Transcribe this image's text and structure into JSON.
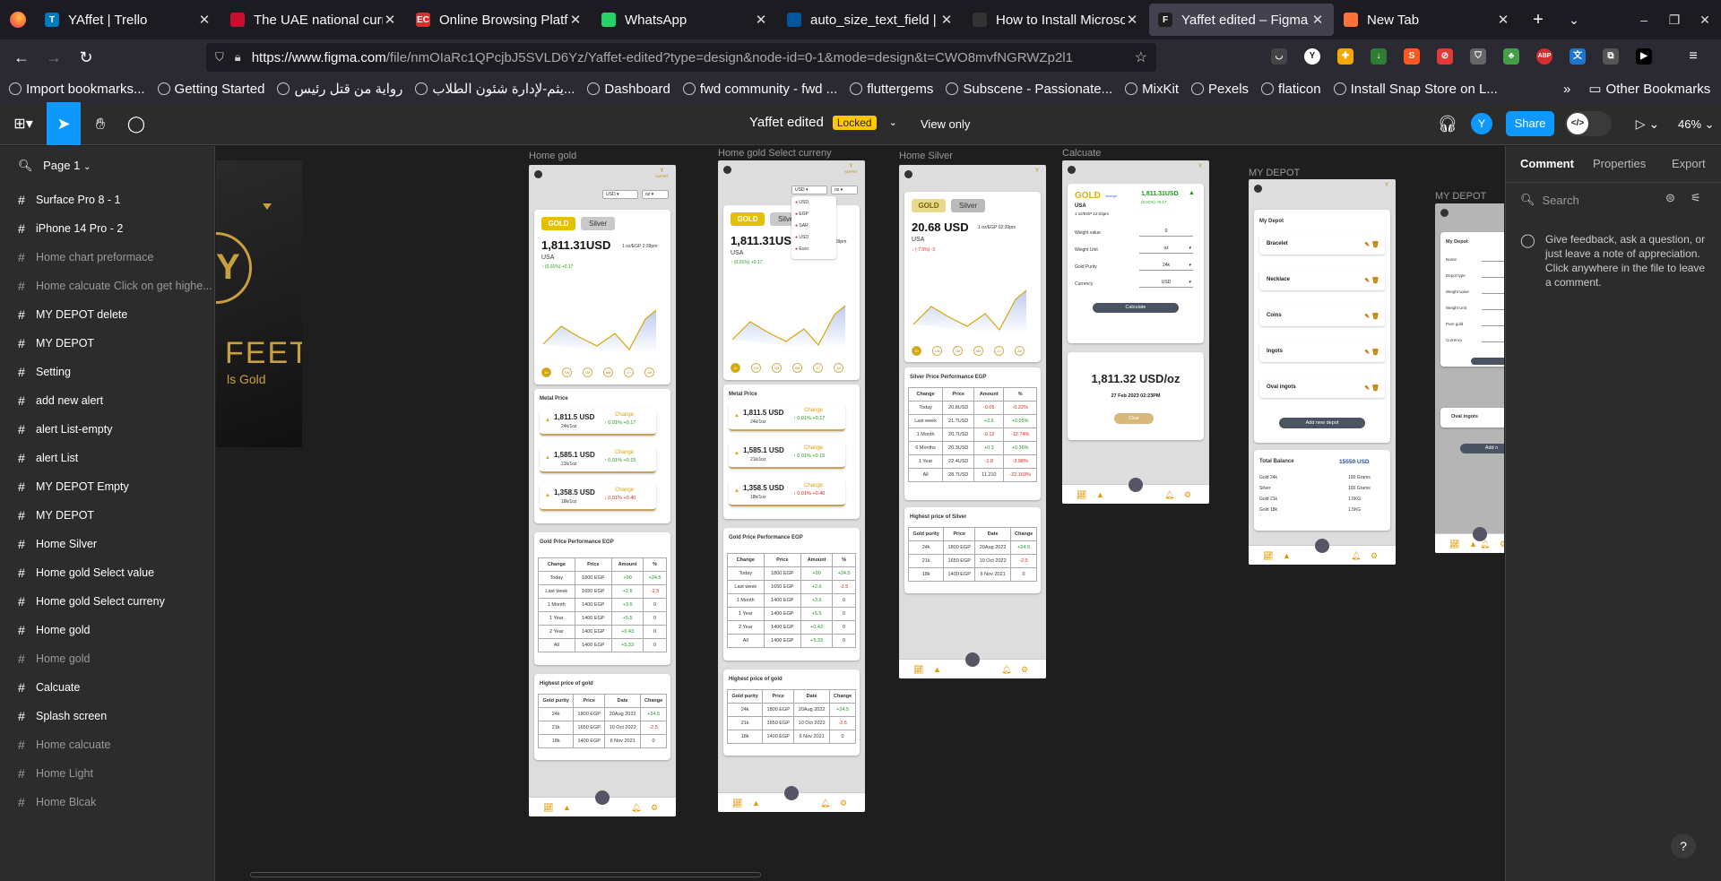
{
  "browser": {
    "tabs": [
      {
        "title": "YAffet | Trello",
        "fav_color": "#0079bf",
        "fav_text": "T"
      },
      {
        "title": "The UAE national curre",
        "fav_color": "#c8102e",
        "fav_text": ""
      },
      {
        "title": "Online Browsing Platfo",
        "fav_color": "#d32f2f",
        "fav_text": "EC"
      },
      {
        "title": "WhatsApp",
        "fav_color": "#25d366",
        "fav_text": ""
      },
      {
        "title": "auto_size_text_field |",
        "fav_color": "#02569b",
        "fav_text": ""
      },
      {
        "title": "How to Install Microso",
        "fav_color": "#333",
        "fav_text": ""
      },
      {
        "title": "Yaffet edited – Figma",
        "fav_color": "#1e1e1e",
        "fav_text": "F"
      },
      {
        "title": "New Tab",
        "fav_color": "#ff7139",
        "fav_text": ""
      }
    ],
    "url_main": "https://www.figma.com",
    "url_rest": "/file/nmOIaRc1QPcjbJ5SVLD6Yz/Yaffet-edited?type=design&node-id=0-1&mode=design&t=CWO8mvfNGRWZp2l1",
    "bookmarks": [
      "Import bookmarks...",
      "Getting Started",
      "رواية من قتل رئيس",
      "يثم-لإدارة شئون الطلاب...",
      "Dashboard",
      "fwd community - fwd ...",
      "fluttergems",
      "Subscene - Passionate...",
      "MixKit",
      "Pexels",
      "flaticon",
      "Install Snap Store on L..."
    ],
    "other_bookmarks": "Other Bookmarks"
  },
  "figma": {
    "file_title": "Yaffet edited",
    "locked_badge": "Locked",
    "view_only": "View only",
    "share": "Share",
    "avatar_initial": "Y",
    "zoom": "46%",
    "page": "Page 1",
    "layers": [
      {
        "name": "Surface Pro 8 - 1",
        "dim": false
      },
      {
        "name": "iPhone 14 Pro - 2",
        "dim": false
      },
      {
        "name": "Home chart preformace",
        "dim": true
      },
      {
        "name": "Home calcuate Click on get highe...",
        "dim": true
      },
      {
        "name": "MY DEPOT delete",
        "dim": false
      },
      {
        "name": "MY DEPOT",
        "dim": false
      },
      {
        "name": "Setting",
        "dim": false
      },
      {
        "name": "add new alert",
        "dim": false
      },
      {
        "name": "alert List-empty",
        "dim": false
      },
      {
        "name": "alert List",
        "dim": false
      },
      {
        "name": "MY DEPOT Empty",
        "dim": false
      },
      {
        "name": "MY DEPOT",
        "dim": false
      },
      {
        "name": "Home Silver",
        "dim": false
      },
      {
        "name": "Home gold Select value",
        "dim": false
      },
      {
        "name": "Home gold Select curreny",
        "dim": false
      },
      {
        "name": "Home gold",
        "dim": false
      },
      {
        "name": "Home gold",
        "dim": true
      },
      {
        "name": "Calcuate",
        "dim": false
      },
      {
        "name": "Splash screen",
        "dim": false
      },
      {
        "name": "Home calcuate",
        "dim": true
      },
      {
        "name": "Home Light",
        "dim": true
      },
      {
        "name": "Home Blcak",
        "dim": true
      }
    ],
    "right_tabs": [
      "Comment",
      "Properties",
      "Export"
    ],
    "search_placeholder": "Search",
    "comment_note": "Give feedback, ask a question, or just leave a note of appreciation. Click anywhere in the file to leave a comment.",
    "help": "?"
  },
  "frames": {
    "home_gold": "Home gold",
    "home_gold_select": "Home gold Select curreny",
    "home_silver": "Home Silver",
    "calculate": "Calcuate",
    "my_depot": "MY DEPOT",
    "my_depot2": "MY DEPOT"
  },
  "splash": {
    "brand": "FEET",
    "tag": "ls Gold"
  },
  "app": {
    "currency": "USD",
    "unit": "oz",
    "gold": "GOLD",
    "silver": "Silver",
    "gold_price": "1,811.31USD",
    "gold_sub": "1 oz/EGP 2:39pm",
    "region": "USA",
    "gold_change": "(0.01%) +0.17",
    "silver_price": "20.68 USD",
    "silver_sub": "1 oz/EGP 02:39pm",
    "silver_change": "(-7.5%) -3",
    "times": [
      "1D",
      "1W",
      "1M",
      "6M",
      "1Y",
      "All"
    ],
    "metal_price_title": "Metal Price",
    "metal_rows": [
      {
        "price": "1,811.5 USD",
        "karat": "24k/1oz",
        "change": "0.01% +0.17",
        "dir": "up"
      },
      {
        "price": "1,585.1 USD",
        "karat": "21k/1oz",
        "change": "0.01% +0.15",
        "dir": "up"
      },
      {
        "price": "1,358.5 USD",
        "karat": "18k/1oz",
        "change": "0.01% +0.40",
        "dir": "dn"
      }
    ],
    "change_label": "Change",
    "perf_title": "Gold Price Performance EGP",
    "perf_header": [
      "Change",
      "Price",
      "Amount",
      "%"
    ],
    "perf_rows": [
      [
        "Today",
        "1800 EGP",
        "+90",
        "+24.5"
      ],
      [
        "Last week",
        "1650 EGP",
        "+2.6",
        "-2.5"
      ],
      [
        "1 Month",
        "1400 EGP",
        "+3.6",
        "0"
      ],
      [
        "1 Year",
        "1400 EGP",
        "+5.5",
        "0"
      ],
      [
        "2 Year",
        "1400 EGP",
        "+0.43",
        "0"
      ],
      [
        "All",
        "1400 EGP",
        "+5.33",
        "0"
      ]
    ],
    "high_title": "Highest price of gold",
    "high_header": [
      "Gold purity",
      "Price",
      "Date",
      "Change"
    ],
    "high_rows": [
      [
        "24k",
        "1800 EGP",
        "20Aug 2022",
        "+24.5"
      ],
      [
        "21k",
        "1650 EGP",
        "10 Oct 2022",
        "-2.5"
      ],
      [
        "18k",
        "1400 EGP",
        "6 Nov 2021",
        "0"
      ]
    ],
    "currency_options": [
      "USD",
      "EGP",
      "SAR",
      "USD",
      "Euro"
    ],
    "silver_perf_title": "Silver Price Performance EGP",
    "silver_rows": [
      [
        "Today",
        "20.8USD",
        "-0.05",
        "-0.22%"
      ],
      [
        "Last week",
        "21.7USD",
        "+2.6",
        "+0.05%"
      ],
      [
        "1 Month",
        "20.7USD",
        "-0.12",
        "-12.74%"
      ],
      [
        "6 Months",
        "20.3USD",
        "+0.3",
        "+0.36%"
      ],
      [
        "1 Year",
        "22.4USD",
        "-1.8",
        "-3.98%"
      ],
      [
        "All",
        "28.7USD",
        "11.210",
        "-22.160%"
      ]
    ],
    "silver_high_title": "Highest price of Silver",
    "calc": {
      "gold": "GOLD",
      "change": "change",
      "usd": "USA",
      "price": "1,811.31USD",
      "pct": "(0.01%) +0.17",
      "sub": "1 oz/EGP 12:03pm",
      "fields": [
        [
          "Weight value",
          "0"
        ],
        [
          "Weight Unit",
          "oz"
        ],
        [
          "Gold Purity",
          "24k"
        ],
        [
          "Currency",
          "USD"
        ]
      ],
      "calc_btn": "Calculate",
      "result": "1,811.32 USD/oz",
      "result_date": "27 Feb 2023 02:23PM",
      "clear": "Clear"
    },
    "depot": {
      "title": "My Depot",
      "items": [
        "Bracelet",
        "Necklace",
        "Coins",
        "Ingots",
        "Oval ingots"
      ],
      "add_btn": "Add new depot",
      "total_title": "Total Balance",
      "total_value": "15550 USD",
      "totals": [
        [
          "Gold 24k",
          "100 Grams"
        ],
        [
          "Silver",
          "100 Grams"
        ],
        [
          "Gold 21k",
          "1.5KG"
        ],
        [
          "Gold 18k",
          "1.5KG"
        ]
      ]
    },
    "depot2": {
      "title": "My Depot",
      "fields": [
        "Name",
        "Depot type",
        "Weight value",
        "Weight Unit",
        "Pure gold",
        "Currency"
      ],
      "oval": "Oval ingots",
      "add": "Add n"
    },
    "logo": "YAFFET"
  }
}
